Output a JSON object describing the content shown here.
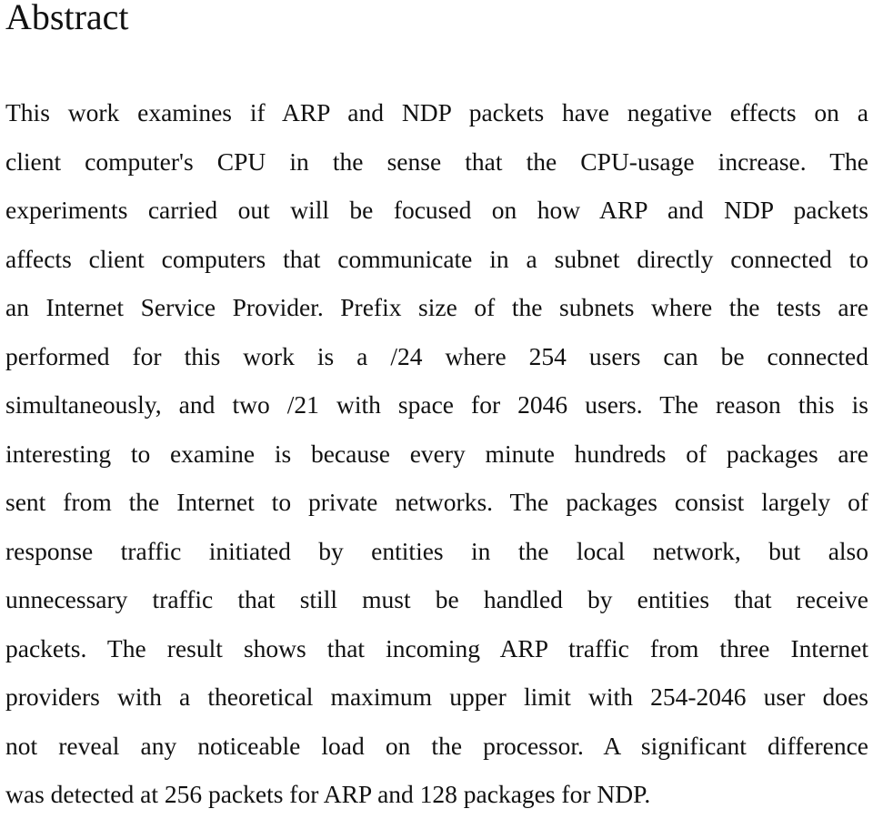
{
  "document": {
    "title": "Abstract",
    "body_lines": [
      "This work examines if ARP and NDP packets have negative effects on a",
      "client computer's CPU in the sense that the CPU-usage increase. The",
      "experiments carried out will be focused on how ARP and NDP packets",
      "affects client computers that communicate in a subnet directly connected to",
      "an Internet Service Provider. Prefix size of the subnets where the tests are",
      "performed for this work is a /24 where 254 users can be connected",
      "simultaneously, and two /21 with space for 2046 users. The reason this is",
      "interesting to examine is because every minute hundreds of packages are",
      "sent from the Internet to private networks. The packages consist largely of",
      "response traffic initiated by entities in the local network, but also",
      "unnecessary traffic that still must be handled by entities that receive",
      "packets. The result shows that incoming ARP traffic from three Internet",
      "providers with a theoretical maximum upper limit with 254-2046 user does",
      "not reveal any noticeable load on the processor. A significant difference",
      "was detected at 256 packets for ARP and 128 packages for NDP."
    ]
  }
}
